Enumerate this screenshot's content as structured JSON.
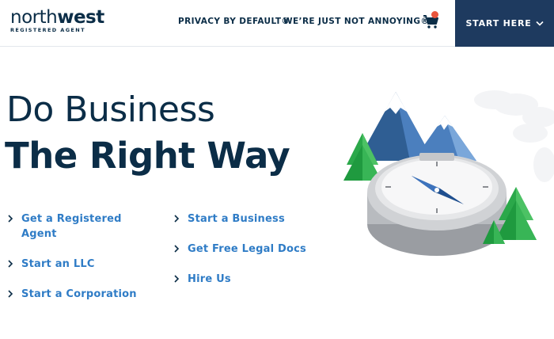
{
  "brand": {
    "logo_light": "north",
    "logo_bold": "west",
    "logo_sub": "REGISTERED AGENT"
  },
  "nav": {
    "privacy": "PRIVACY BY DEFAULT®",
    "annoying": "WE’RE JUST NOT ANNOYING®",
    "cart_icon": "cart-icon",
    "start_here": "START HERE"
  },
  "colors": {
    "navy": "#0b2d47",
    "button_bg": "#1e3a5f",
    "link_blue": "#2f7cc6",
    "badge": "#e8553d"
  },
  "hero": {
    "line1": "Do Business",
    "line2": "The Right Way"
  },
  "links_left": [
    {
      "label": "Get a Registered Agent"
    },
    {
      "label": "Start an LLC"
    },
    {
      "label": "Start a Corporation"
    }
  ],
  "links_right": [
    {
      "label": "Start a Business"
    },
    {
      "label": "Get Free Legal Docs"
    },
    {
      "label": "Hire Us"
    }
  ]
}
